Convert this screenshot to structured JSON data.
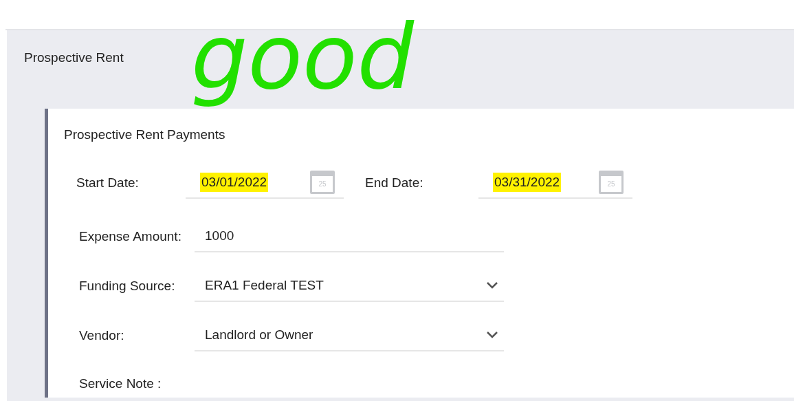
{
  "annotation": {
    "text": "good"
  },
  "section": {
    "title": "Prospective Rent"
  },
  "card": {
    "title": "Prospective Rent Payments",
    "dates": [
      {
        "label": "Start Date:",
        "value": "03/01/2022",
        "highlighted": true,
        "calendar_day": "25"
      },
      {
        "label": "End Date:",
        "value": "03/31/2022",
        "highlighted": true,
        "calendar_day": "25"
      }
    ],
    "fields": [
      {
        "kind": "text",
        "label": "Expense Amount:",
        "value": "1000"
      },
      {
        "kind": "select",
        "label": "Funding Source:",
        "value": "ERA1 Federal TEST"
      },
      {
        "kind": "select",
        "label": "Vendor:",
        "value": "Landlord or Owner"
      },
      {
        "kind": "label",
        "label": "Service Note :"
      }
    ]
  }
}
